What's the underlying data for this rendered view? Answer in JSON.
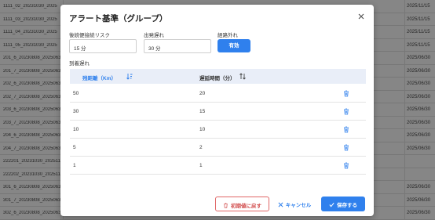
{
  "background": {
    "rows": [
      {
        "c1": "1111_02_20231030_2025",
        "c2": "2025/11/15"
      },
      {
        "c1": "1111_03_20231030_2025",
        "c2": "2025/11/15"
      },
      {
        "c1": "1111_04_20231030_2025",
        "c2": "2025/11/15"
      },
      {
        "c1": "1111_05_20231030_2025",
        "c2": "2025/11/15"
      },
      {
        "c1": "201_6_20230808_2025063",
        "c2": "2025/06/30"
      },
      {
        "c1": "201_7_20230808_2025063",
        "c2": "2025/06/30"
      },
      {
        "c1": "202_6_20230808_2025063",
        "c2": "2025/06/30"
      },
      {
        "c1": "202_7_20230808_2025063",
        "c2": "2025/06/30"
      },
      {
        "c1": "203_6_20230808_2025063",
        "c2": "2025/06/30"
      },
      {
        "c1": "203_7_20230808_2025063",
        "c2": "2025/06/30"
      },
      {
        "c1": "204_6_20230808_2025063",
        "c2": "2025/06/30"
      },
      {
        "c1": "204_7_20230808_2025063",
        "c2": "2025/06/30"
      },
      {
        "c1": "222201_20231030_202511",
        "c2": ""
      },
      {
        "c1": "222202_20231030_202511",
        "c2": ""
      },
      {
        "c1": "301_6_20230808_2025063",
        "c2": "2025/06/30"
      },
      {
        "c1": "301_7_20230808_2025063",
        "c2": "2025/06/30"
      },
      {
        "c1": "302_6_20230808_2025063",
        "c2": "2025/06/30"
      }
    ]
  },
  "dialog": {
    "title": "アラート基準（グループ）",
    "close_icon": "close-icon",
    "connection_risk_label": "後続便接続リスク",
    "connection_risk_value": "15 分",
    "departure_delay_label": "出発遅れ",
    "departure_delay_value": "30 分",
    "route_deviation_label": "経路外れ",
    "route_deviation_button": "有効",
    "arrival_delay_label": "到着遅れ",
    "table": {
      "col1": "残距離（Km）",
      "col2": "遅延時間（分）",
      "rows": [
        {
          "distance": "50",
          "delay": "20"
        },
        {
          "distance": "30",
          "delay": "15"
        },
        {
          "distance": "10",
          "delay": "10"
        },
        {
          "distance": "5",
          "delay": "2"
        },
        {
          "distance": "1",
          "delay": "1"
        }
      ]
    },
    "reset_button": "初期値に戻す",
    "cancel_button": "キャンセル",
    "save_button": "保存する"
  },
  "colors": {
    "accent": "#2f80ed",
    "danger": "#d14b4b",
    "table_header_bg": "#e9eef8"
  }
}
